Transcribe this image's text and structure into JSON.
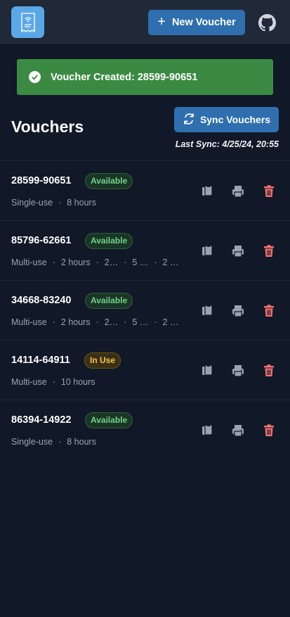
{
  "header": {
    "new_voucher_label": "New Voucher"
  },
  "toast": {
    "message": "Voucher Created: 28599-90651"
  },
  "page": {
    "title": "Vouchers",
    "sync_label": "Sync Vouchers",
    "last_sync": "Last Sync: 4/25/24, 20:55"
  },
  "vouchers": [
    {
      "code": "28599-90651",
      "status": "Available",
      "meta": [
        "Single-use",
        "8 hours"
      ]
    },
    {
      "code": "85796-62661",
      "status": "Available",
      "meta": [
        "Multi-use",
        "2 hours",
        "2…",
        "5 …",
        "2 …"
      ]
    },
    {
      "code": "34668-83240",
      "status": "Available",
      "meta": [
        "Multi-use",
        "2 hours",
        "2…",
        "5 …",
        "2 …"
      ]
    },
    {
      "code": "14114-64911",
      "status": "In Use",
      "meta": [
        "Multi-use",
        "10 hours"
      ]
    },
    {
      "code": "86394-14922",
      "status": "Available",
      "meta": [
        "Single-use",
        "8 hours"
      ]
    }
  ],
  "colors": {
    "background": "#111827",
    "primary_button": "#2f6fb0",
    "success_toast": "#3b8a43",
    "delete_icon": "#f87171",
    "available_text": "#6fd28a",
    "in_use_text": "#f5c542"
  },
  "icons": [
    "receipt-wifi-logo-icon",
    "plus-icon",
    "github-icon",
    "check-circle-icon",
    "sync-icon",
    "copy-icon",
    "print-icon",
    "trash-icon"
  ]
}
